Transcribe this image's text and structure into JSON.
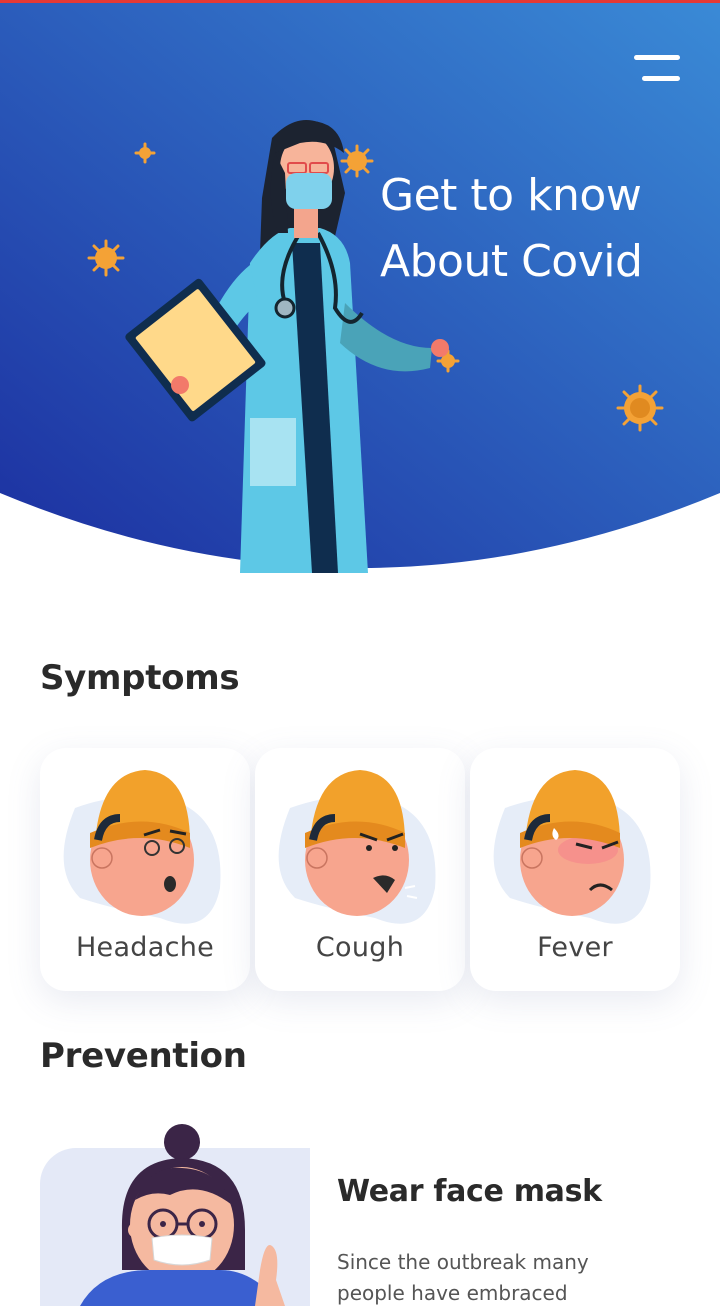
{
  "colors": {
    "hero_gradient_start": "#1c2fa0",
    "hero_gradient_end": "#3a8ad6",
    "accent_red": "#e53935",
    "virus_orange": "#f4a236",
    "card_background": "#ffffff"
  },
  "header": {
    "menu_icon": "hamburger-menu-icon",
    "title_line1": "Get to know",
    "title_line2": "About Covid"
  },
  "symptoms": {
    "title": "Symptoms",
    "items": [
      {
        "label": "Headache",
        "icon": "headache-face-illustration"
      },
      {
        "label": "Cough",
        "icon": "cough-face-illustration"
      },
      {
        "label": "Fever",
        "icon": "fever-face-illustration"
      }
    ]
  },
  "prevention": {
    "title": "Prevention",
    "items": [
      {
        "heading": "Wear face mask",
        "text": "Since the outbreak many people have embraced",
        "icon": "woman-wearing-mask-illustration"
      }
    ]
  }
}
